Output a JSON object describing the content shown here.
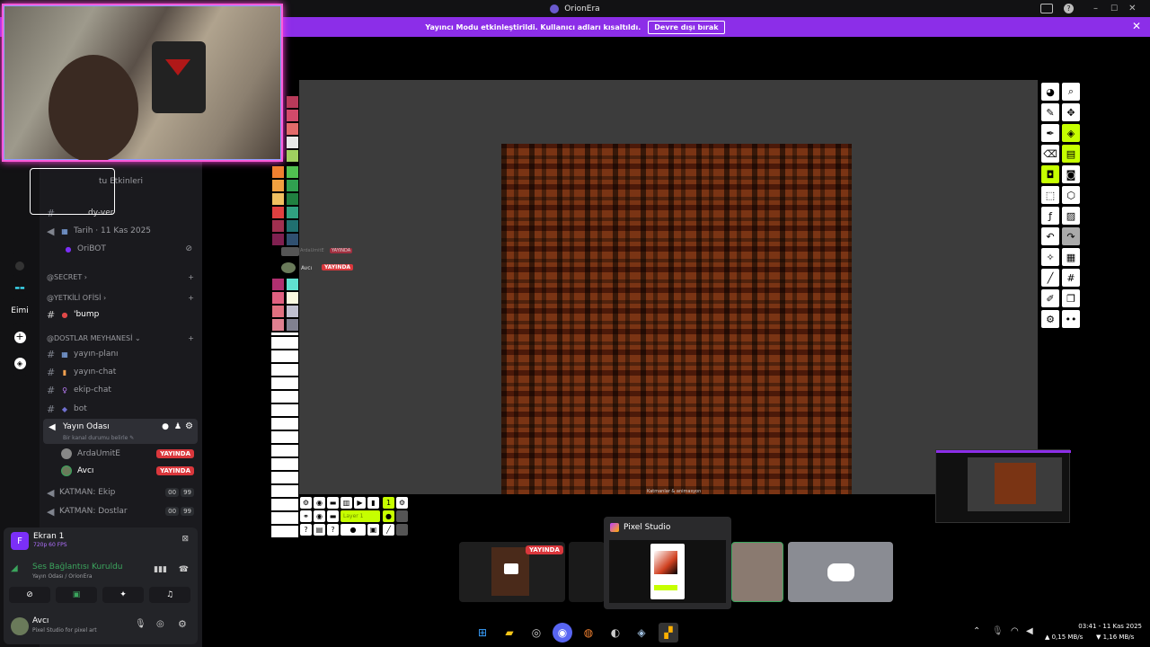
{
  "window": {
    "title": "OrionEra",
    "minimize": "–",
    "maximize": "☐",
    "close": "✕"
  },
  "banner": {
    "text": "Yayıncı Modu etkinleştirildi. Kullanıcı adları kısaltıldı.",
    "button": "Devre dışı bırak",
    "close": "✕"
  },
  "sidebar": {
    "guild_label": "Eimi",
    "partial_text": "tu Etkinleri",
    "channels": [
      {
        "name": "dy-ver",
        "emoji": ""
      },
      {
        "name": "Tarih · 11 Kas 2025",
        "emoji": "▦"
      },
      {
        "name": "OriBOT",
        "emoji": "●"
      }
    ],
    "categories": [
      {
        "name": "@SECRET",
        "chev": "›",
        "add": "+"
      },
      {
        "name": "@YETKİLİ OFİSİ",
        "chev": "›",
        "add": "+"
      },
      {
        "name": "@DOSTLAR MEYHANESİ",
        "chev": "⌄",
        "add": "+"
      }
    ],
    "bump": "'bump",
    "text_channels": [
      {
        "name": "yayın-planı",
        "emoji": "▦"
      },
      {
        "name": "yayın-chat",
        "emoji": "▮"
      },
      {
        "name": "ekip-chat",
        "emoji": "♀"
      },
      {
        "name": "bot",
        "emoji": "◆"
      }
    ],
    "voice_active": {
      "name": "Yayın Odası",
      "status": "Bir kanal durumu belirle ✎"
    },
    "voice_users": [
      {
        "name": "ArdaUmitE",
        "badge": "YAYINDA"
      },
      {
        "name": "Avcı",
        "badge": "YAYINDA"
      }
    ],
    "voice_channels": [
      {
        "name": "KATMAN: Ekip",
        "count_a": "00",
        "count_b": "99"
      },
      {
        "name": "KATMAN: Dostlar",
        "count_a": "00",
        "count_b": "99"
      }
    ],
    "screen_share": {
      "title": "Ekran 1",
      "sub": "720p 60 FPS",
      "letter": "F"
    },
    "voice_status": {
      "title": "Ses Bağlantısı Kuruldu",
      "sub": "Yayın Odası / OrionEra"
    },
    "user": {
      "name": "Avcı",
      "activity": "Pixel Studio for pixel art"
    }
  },
  "stream": {
    "overlay_users": [
      {
        "name": "ArdaUmitE",
        "badge": "YAYINDA"
      },
      {
        "name": "Avcı",
        "badge": "YAYINDA"
      }
    ],
    "layer_label": "Layer 1",
    "caption": "Katmanlar & animasyon"
  },
  "taskbar_preview": {
    "title": "Pixel Studio",
    "thumb_badge": "YAYINDA"
  },
  "clock": {
    "time": "03:41 - 11 Kas 2025",
    "up": "▲ 0,15 MB/s",
    "down": "▼ 1,16 MB/s"
  },
  "colors": {
    "banner": "#8c2ee8",
    "accent_green": "#c6ff00",
    "live_red": "#da373c",
    "art_brown": "#7a3414"
  }
}
